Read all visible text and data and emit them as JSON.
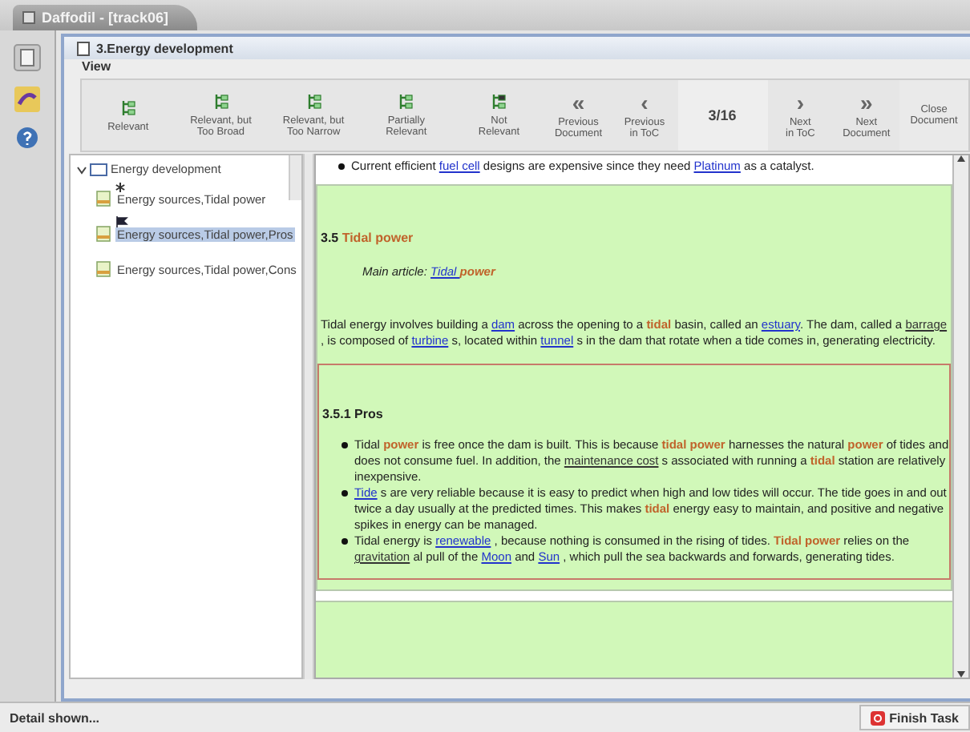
{
  "window": {
    "title": "Daffodil - [track06]"
  },
  "document": {
    "title": "3.Energy development",
    "menu": [
      "View"
    ]
  },
  "toolbar": [
    {
      "kind": "judge",
      "label": "Relevant"
    },
    {
      "kind": "judge",
      "label": "Relevant, but\nToo Broad"
    },
    {
      "kind": "judge",
      "label": "Relevant, but\nToo Narrow"
    },
    {
      "kind": "judge",
      "label": "Partially\nRelevant"
    },
    {
      "kind": "reject",
      "label": "Not\nRelevant"
    },
    {
      "kind": "nav",
      "icon": "«",
      "label": "Previous\nDocument"
    },
    {
      "kind": "nav",
      "icon": "‹",
      "label": "Previous\nin ToC"
    },
    {
      "kind": "counter",
      "label": "3/16"
    },
    {
      "kind": "nav",
      "icon": "›",
      "label": "Next\nin ToC"
    },
    {
      "kind": "nav",
      "icon": "»",
      "label": "Next\nDocument"
    },
    {
      "kind": "close",
      "label": "Close\nDocument"
    }
  ],
  "tree": {
    "label": "Energy development",
    "expanded": true,
    "children": [
      {
        "kind": "starred",
        "label": "Energy sources,Tidal power",
        "selected": false
      },
      {
        "kind": "flagged",
        "label": "Energy sources,Tidal power,Pros",
        "selected": true
      },
      {
        "kind": "plain",
        "label": "Energy sources,Tidal power,Cons",
        "selected": false
      }
    ]
  },
  "content": {
    "bullets_top": [
      [
        "Current efficient ",
        {
          "kind": "link",
          "text": "fuel cell"
        },
        " designs are expensive since they need ",
        {
          "kind": "link",
          "text": "Platinum"
        },
        " as a catalyst."
      ]
    ],
    "section": {
      "heading": [
        "3.5 ",
        {
          "kind": "term",
          "text": "Tidal power"
        }
      ],
      "main_article": [
        "Main article: ",
        {
          "kind": "link",
          "text": "Tidal "
        },
        {
          "kind": "term",
          "text": "power"
        }
      ],
      "paragraph": [
        "Tidal energy involves building a ",
        {
          "kind": "link",
          "text": "dam"
        },
        " across the opening to a ",
        {
          "kind": "term",
          "text": "tidal"
        },
        " basin, called an ",
        {
          "kind": "link",
          "text": "estuary"
        },
        ". The dam, called a ",
        {
          "kind": "dark-link",
          "text": "barrage"
        },
        " , is composed of ",
        {
          "kind": "link",
          "text": "turbine"
        },
        " s, located within ",
        {
          "kind": "link",
          "text": "tunnel"
        },
        " s in the dam that rotate when a tide comes in, generating electricity."
      ],
      "subsection": {
        "heading": [
          "3.5.1 Pros"
        ],
        "bullets": [
          [
            "Tidal ",
            {
              "kind": "term",
              "text": "power"
            },
            " is free once the dam is built. This is because ",
            {
              "kind": "term",
              "text": "tidal power"
            },
            " harnesses the natural ",
            {
              "kind": "term",
              "text": "power"
            },
            " of tides and does not consume fuel. In addition, the ",
            {
              "kind": "dark-link",
              "text": "maintenance cost"
            },
            " s associated with running a ",
            {
              "kind": "term",
              "text": "tidal"
            },
            " station are relatively inexpensive."
          ],
          [
            {
              "kind": "link",
              "text": "Tide"
            },
            " s are very reliable because it is easy to predict when high and low tides will occur. The tide goes in and out twice a day usually at the predicted times. This makes ",
            {
              "kind": "term",
              "text": "tidal"
            },
            " energy easy to maintain, and positive and negative spikes in energy can be managed."
          ],
          [
            "Tidal energy is ",
            {
              "kind": "link",
              "text": "renewable"
            },
            " , because nothing is consumed in the rising of tides. ",
            {
              "kind": "term",
              "text": "Tidal power"
            },
            " relies on the ",
            {
              "kind": "dark-link",
              "text": "gravitation"
            },
            " al pull of the ",
            {
              "kind": "link",
              "text": "Moon"
            },
            " and ",
            {
              "kind": "link",
              "text": "Sun"
            },
            " , which pull the sea backwards and forwards, generating tides."
          ]
        ]
      }
    }
  },
  "status_bar": {
    "message": "Detail shown...",
    "button": "Finish Task"
  }
}
